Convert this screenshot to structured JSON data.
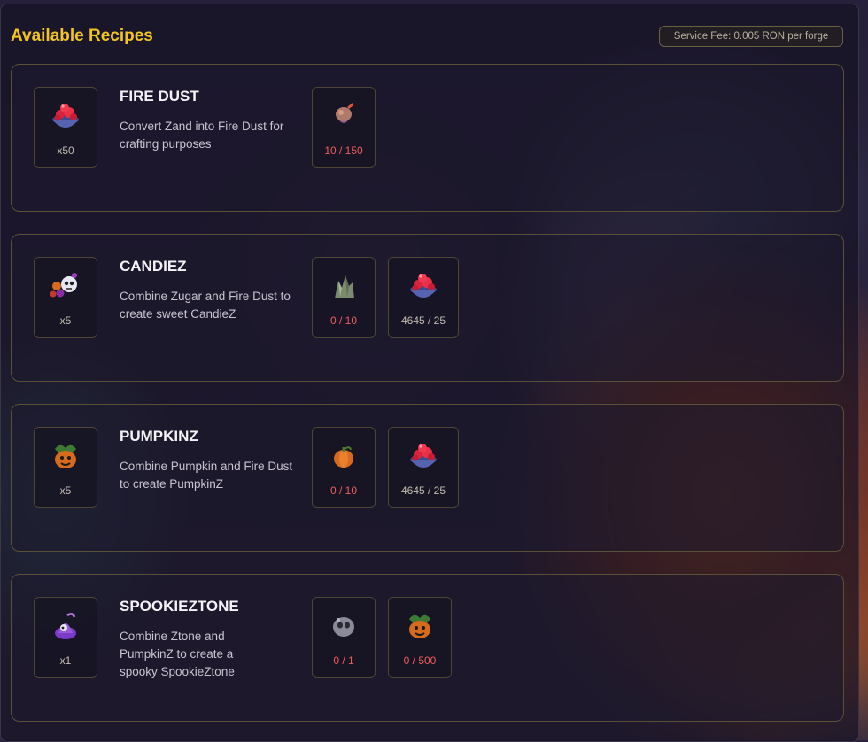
{
  "header": {
    "title": "Available Recipes",
    "service_fee": "Service Fee: 0.005 RON per forge"
  },
  "recipes": [
    {
      "name": "FIRE DUST",
      "description": "Convert Zand into Fire Dust for crafting purposes",
      "output": {
        "icon": "fire-dust-bowl-icon",
        "quantity": "x50"
      },
      "inputs": [
        {
          "icon": "zand-icon",
          "amount": "10 / 150",
          "status": "insufficient"
        }
      ]
    },
    {
      "name": "CANDIEZ",
      "description": "Combine Zugar and Fire Dust to create sweet CandieZ",
      "output": {
        "icon": "candiez-icon",
        "quantity": "x5"
      },
      "inputs": [
        {
          "icon": "zugar-icon",
          "amount": "0 / 10",
          "status": "insufficient"
        },
        {
          "icon": "fire-dust-bowl-icon",
          "amount": "4645 / 25",
          "status": "sufficient"
        }
      ]
    },
    {
      "name": "PUMPKINZ",
      "description": "Combine Pumpkin and Fire Dust to create PumpkinZ",
      "output": {
        "icon": "pumpkinz-icon",
        "quantity": "x5"
      },
      "inputs": [
        {
          "icon": "pumpkin-icon",
          "amount": "0 / 10",
          "status": "insufficient"
        },
        {
          "icon": "fire-dust-bowl-icon",
          "amount": "4645 / 25",
          "status": "sufficient"
        }
      ]
    },
    {
      "name": "SPOOKIEZTONE",
      "description": "Combine Ztone and PumpkinZ to create a spooky SpookieZtone",
      "output": {
        "icon": "spookieztone-icon",
        "quantity": "x1"
      },
      "inputs": [
        {
          "icon": "ztone-icon",
          "amount": "0 / 1",
          "status": "insufficient"
        },
        {
          "icon": "pumpkinz-icon",
          "amount": "0 / 500",
          "status": "insufficient"
        }
      ]
    }
  ],
  "colors": {
    "title": "#f2c423",
    "insufficient": "#ef5c5c",
    "sufficient": "#c4bcb0",
    "card_border": "#5a5038"
  }
}
